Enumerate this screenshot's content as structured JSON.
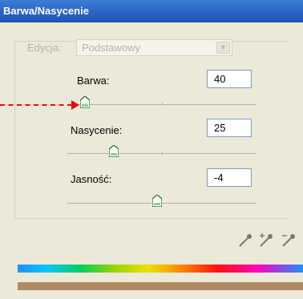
{
  "dialog": {
    "title": "Barwa/Nasycenie",
    "edit": {
      "label": "Edycja:",
      "value": "Podstawowy",
      "disabled": true
    },
    "sliders": [
      {
        "label": "Barwa:",
        "value": "40"
      },
      {
        "label": "Nasycenie:",
        "value": "25"
      },
      {
        "label": "Jasność:",
        "value": "-4"
      }
    ]
  },
  "icons": [
    "eyedropper-icon",
    "eyedropper-plus-icon",
    "eyedropper-minus-icon"
  ],
  "colors": {
    "titlebar": "#2a63c7",
    "annotation_arrow": "#e01010",
    "hue_bar": "#b08a60"
  }
}
